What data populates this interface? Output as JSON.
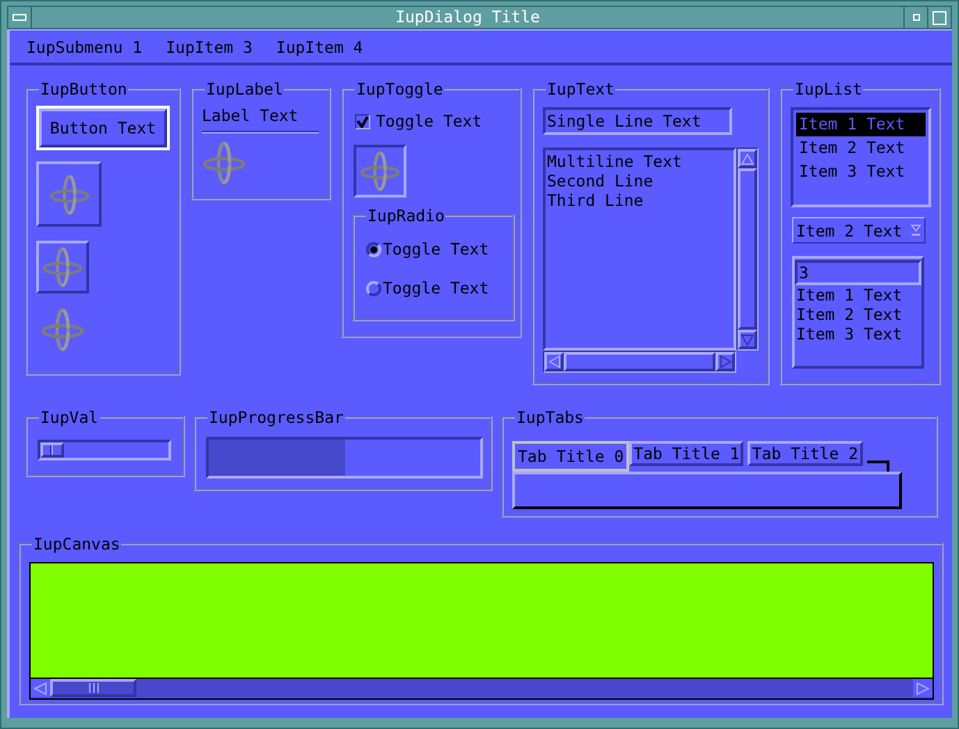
{
  "window": {
    "title": "IupDialog Title"
  },
  "menu": [
    {
      "label": "IupSubmenu 1"
    },
    {
      "label": "IupItem 3"
    },
    {
      "label": "IupItem 4"
    }
  ],
  "button_frame": {
    "title": "IupButton",
    "button": "Button Text"
  },
  "label_frame": {
    "title": "IupLabel",
    "label": "Label Text"
  },
  "toggle_frame": {
    "title": "IupToggle",
    "toggle": {
      "label": "Toggle Text",
      "checked": true
    },
    "image_toggle": {
      "checked": true
    },
    "radio": {
      "title": "IupRadio",
      "options": [
        {
          "label": "Toggle Text",
          "selected": true
        },
        {
          "label": "Toggle Text",
          "selected": false
        }
      ]
    }
  },
  "text_frame": {
    "title": "IupText",
    "single_line": "Single Line Text",
    "multiline": [
      "Multiline Text",
      "Second Line",
      "Third Line"
    ]
  },
  "list_frame": {
    "title": "IupList",
    "items": [
      {
        "label": "Item 1 Text",
        "selected": true
      },
      {
        "label": "Item 2 Text",
        "selected": false
      },
      {
        "label": "Item 3 Text",
        "selected": false
      }
    ],
    "dropdown": "Item 2 Text",
    "combo": {
      "value": "3",
      "items": [
        "Item 1 Text",
        "Item 2 Text",
        "Item 3 Text"
      ]
    }
  },
  "val_frame": {
    "title": "IupVal",
    "level": 0
  },
  "progress_frame": {
    "title": "IupProgressBar",
    "level": 0.5
  },
  "tabs_frame": {
    "title": "IupTabs",
    "tabs": [
      {
        "label": "Tab Title 0",
        "selected": true
      },
      {
        "label": "Tab Title 1",
        "selected": false
      },
      {
        "label": "Tab Title 2",
        "selected": false
      }
    ]
  },
  "canvas_frame": {
    "title": "IupCanvas"
  }
}
